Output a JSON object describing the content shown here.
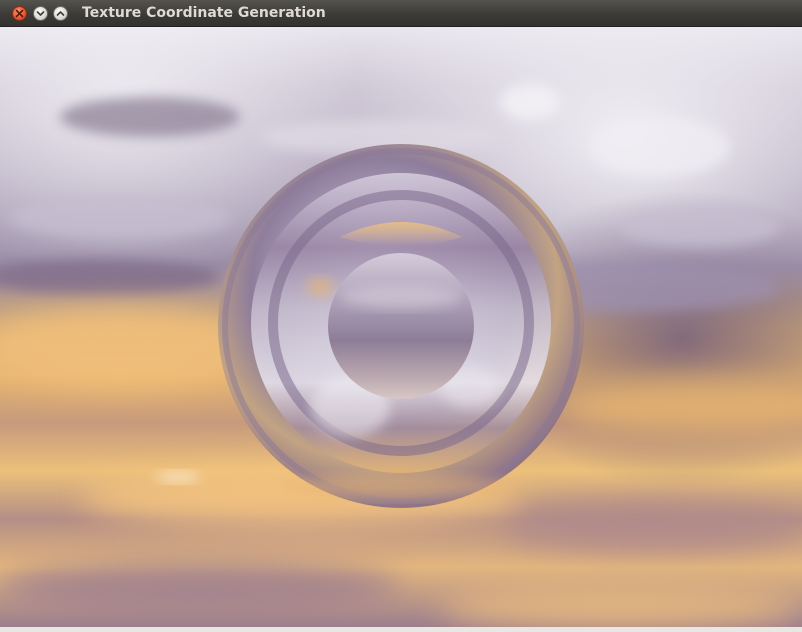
{
  "window": {
    "title": "Texture Coordinate Generation",
    "controls": {
      "close_icon": "close-icon",
      "minimize_icon": "minimize-icon",
      "maximize_icon": "maximize-icon"
    }
  },
  "scene": {
    "content": "reflective torus over sky environment map",
    "colors": {
      "sky_light": "#e9e6ec",
      "sky_mid": "#b9b1c3",
      "sky_dark": "#7d6c8b",
      "horizon_gold": "#e7b56c",
      "ground_gold": "#f1c27a",
      "ground_shadow": "#8b7186"
    }
  }
}
